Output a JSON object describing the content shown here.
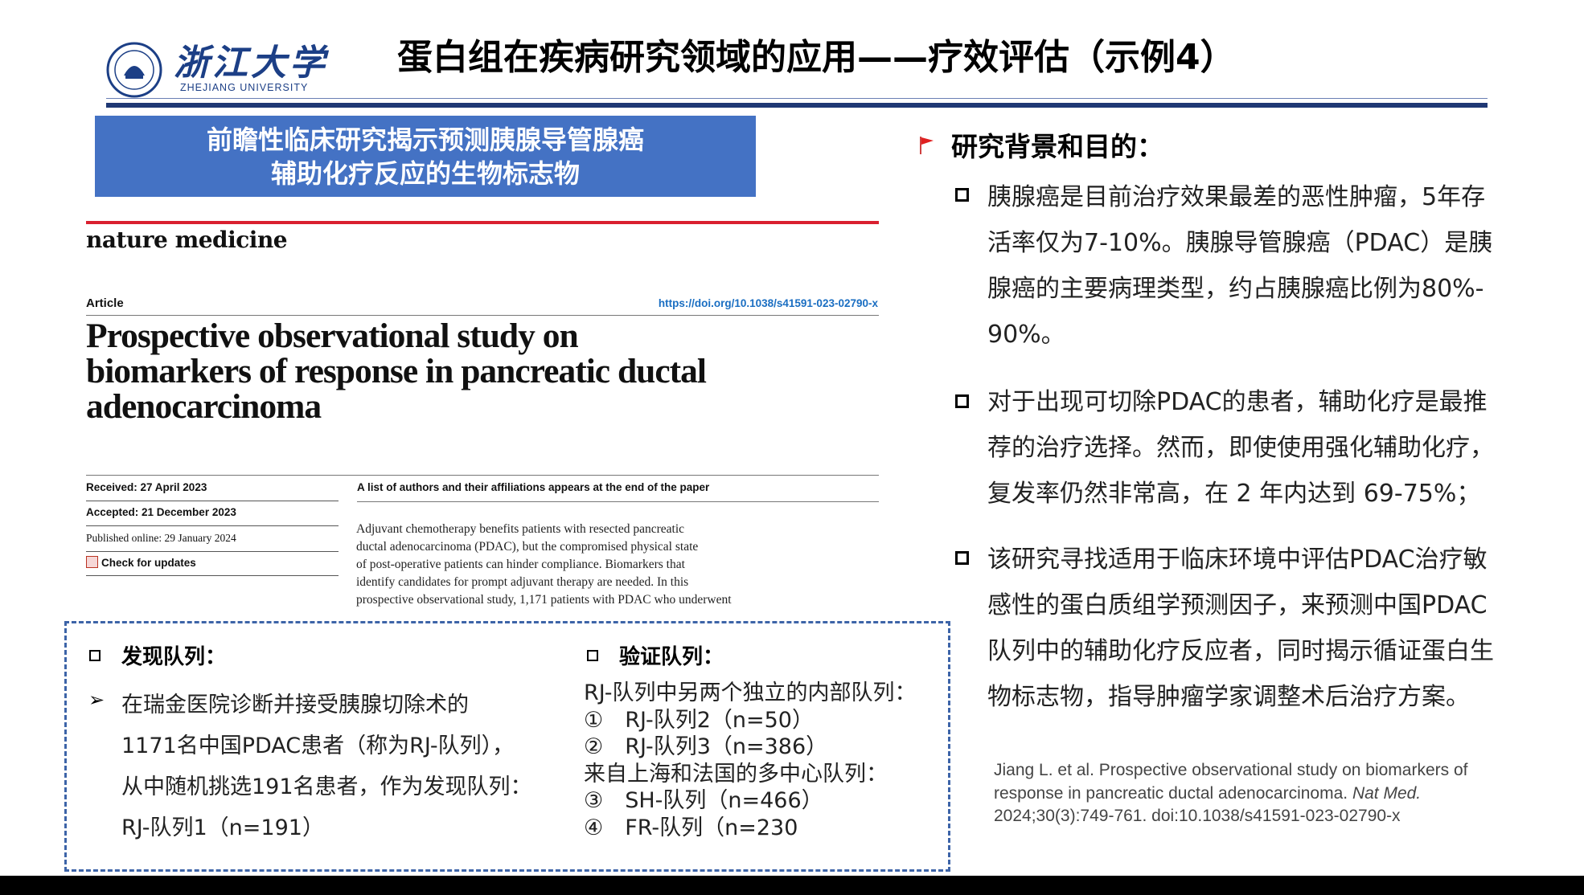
{
  "header": {
    "logo_cn": "浙江大学",
    "logo_en": "ZHEJIANG UNIVERSITY",
    "title": "蛋白组在疾病研究领域的应用——疗效评估（示例4）"
  },
  "banner": {
    "line1": "前瞻性临床研究揭示预测胰腺导管腺癌",
    "line2": "辅助化疗反应的生物标志物"
  },
  "article": {
    "journal": "nature medicine",
    "type": "Article",
    "doi": "https://doi.org/10.1038/s41591-023-02790-x",
    "title_lines": [
      "Prospective observational study on",
      "biomarkers of response in pancreatic ductal",
      "adenocarcinoma"
    ],
    "received": "Received: 27 April 2023",
    "accepted": "Accepted: 21 December 2023",
    "published": "Published online: 29 January 2024",
    "check_updates": "Check for updates",
    "authors_note": "A list of authors and their affiliations appears at the end of the paper",
    "abstract_lines": [
      "Adjuvant chemotherapy benefits patients with resected pancreatic",
      "ductal adenocarcinoma (PDAC), but the compromised physical state",
      "of post-operative patients can hinder compliance. Biomarkers that",
      "identify candidates for prompt adjuvant therapy are needed. In this",
      "prospective observational study, 1,171 patients with PDAC who underwent"
    ]
  },
  "cohorts": {
    "discovery_title": "发现队列：",
    "discovery_arrow": "➢",
    "discovery_lines": [
      "在瑞金医院诊断并接受胰腺切除术的",
      "1171名中国PDAC患者（称为RJ-队列），",
      "从中随机挑选191名患者，作为发现队列：",
      "RJ-队列1（n=191）"
    ],
    "validation_title": "验证队列：",
    "validation_lines": [
      "RJ-队列中另两个独立的内部队列：",
      "①　RJ-队列2（n=50）",
      "②　RJ-队列3（n=386）",
      "来自上海和法国的多中心队列：",
      "③　SH-队列（n=466）",
      "④　FR-队列（n=230"
    ]
  },
  "background": {
    "title": "研究背景和目的：",
    "bullets": [
      {
        "lines": [
          "胰腺癌是目前治疗效果最差的恶性肿瘤，5年存",
          "活率仅为7-10%。胰腺导管腺癌（PDAC）是胰",
          "腺癌的主要病理类型，约占胰腺癌比例为80%-",
          "90%。"
        ]
      },
      {
        "lines": [
          "对于出现可切除PDAC的患者，辅助化疗是最推",
          "荐的治疗选择。然而，即使使用强化辅助化疗，",
          "复发率仍然非常高，在 2 年内达到 69-75%；"
        ]
      },
      {
        "lines": [
          "该研究寻找适用于临床环境中评估PDAC治疗敏",
          "感性的蛋白质组学预测因子，来预测中国PDAC",
          "队列中的辅助化疗反应者，同时揭示循证蛋白生",
          "物标志物，指导肿瘤学家调整术后治疗方案。"
        ]
      }
    ]
  },
  "citation": {
    "line1": "Jiang L. et al. Prospective observational study on biomarkers of",
    "line2_a": "response in pancreatic ductal adenocarcinoma. ",
    "line2_b": "Nat Med.",
    "line3": "2024;30(3):749-761. doi:10.1038/s41591-023-02790-x"
  },
  "colors": {
    "brand_blue": "#1c3f86",
    "banner_blue": "#4472c4",
    "journal_red": "#d9202f",
    "doi_blue": "#1a6ec2",
    "flag_red": "#e02020"
  }
}
